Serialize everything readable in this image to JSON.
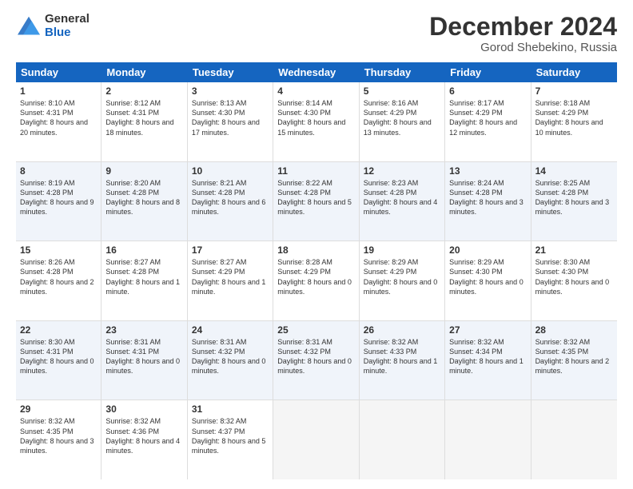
{
  "header": {
    "logo": {
      "general": "General",
      "blue": "Blue"
    },
    "title": "December 2024",
    "subtitle": "Gorod Shebekino, Russia"
  },
  "days_of_week": [
    "Sunday",
    "Monday",
    "Tuesday",
    "Wednesday",
    "Thursday",
    "Friday",
    "Saturday"
  ],
  "weeks": [
    [
      {
        "day": "1",
        "sunrise": "Sunrise: 8:10 AM",
        "sunset": "Sunset: 4:31 PM",
        "daylight": "Daylight: 8 hours and 20 minutes."
      },
      {
        "day": "2",
        "sunrise": "Sunrise: 8:12 AM",
        "sunset": "Sunset: 4:31 PM",
        "daylight": "Daylight: 8 hours and 18 minutes."
      },
      {
        "day": "3",
        "sunrise": "Sunrise: 8:13 AM",
        "sunset": "Sunset: 4:30 PM",
        "daylight": "Daylight: 8 hours and 17 minutes."
      },
      {
        "day": "4",
        "sunrise": "Sunrise: 8:14 AM",
        "sunset": "Sunset: 4:30 PM",
        "daylight": "Daylight: 8 hours and 15 minutes."
      },
      {
        "day": "5",
        "sunrise": "Sunrise: 8:16 AM",
        "sunset": "Sunset: 4:29 PM",
        "daylight": "Daylight: 8 hours and 13 minutes."
      },
      {
        "day": "6",
        "sunrise": "Sunrise: 8:17 AM",
        "sunset": "Sunset: 4:29 PM",
        "daylight": "Daylight: 8 hours and 12 minutes."
      },
      {
        "day": "7",
        "sunrise": "Sunrise: 8:18 AM",
        "sunset": "Sunset: 4:29 PM",
        "daylight": "Daylight: 8 hours and 10 minutes."
      }
    ],
    [
      {
        "day": "8",
        "sunrise": "Sunrise: 8:19 AM",
        "sunset": "Sunset: 4:28 PM",
        "daylight": "Daylight: 8 hours and 9 minutes."
      },
      {
        "day": "9",
        "sunrise": "Sunrise: 8:20 AM",
        "sunset": "Sunset: 4:28 PM",
        "daylight": "Daylight: 8 hours and 8 minutes."
      },
      {
        "day": "10",
        "sunrise": "Sunrise: 8:21 AM",
        "sunset": "Sunset: 4:28 PM",
        "daylight": "Daylight: 8 hours and 6 minutes."
      },
      {
        "day": "11",
        "sunrise": "Sunrise: 8:22 AM",
        "sunset": "Sunset: 4:28 PM",
        "daylight": "Daylight: 8 hours and 5 minutes."
      },
      {
        "day": "12",
        "sunrise": "Sunrise: 8:23 AM",
        "sunset": "Sunset: 4:28 PM",
        "daylight": "Daylight: 8 hours and 4 minutes."
      },
      {
        "day": "13",
        "sunrise": "Sunrise: 8:24 AM",
        "sunset": "Sunset: 4:28 PM",
        "daylight": "Daylight: 8 hours and 3 minutes."
      },
      {
        "day": "14",
        "sunrise": "Sunrise: 8:25 AM",
        "sunset": "Sunset: 4:28 PM",
        "daylight": "Daylight: 8 hours and 3 minutes."
      }
    ],
    [
      {
        "day": "15",
        "sunrise": "Sunrise: 8:26 AM",
        "sunset": "Sunset: 4:28 PM",
        "daylight": "Daylight: 8 hours and 2 minutes."
      },
      {
        "day": "16",
        "sunrise": "Sunrise: 8:27 AM",
        "sunset": "Sunset: 4:28 PM",
        "daylight": "Daylight: 8 hours and 1 minute."
      },
      {
        "day": "17",
        "sunrise": "Sunrise: 8:27 AM",
        "sunset": "Sunset: 4:29 PM",
        "daylight": "Daylight: 8 hours and 1 minute."
      },
      {
        "day": "18",
        "sunrise": "Sunrise: 8:28 AM",
        "sunset": "Sunset: 4:29 PM",
        "daylight": "Daylight: 8 hours and 0 minutes."
      },
      {
        "day": "19",
        "sunrise": "Sunrise: 8:29 AM",
        "sunset": "Sunset: 4:29 PM",
        "daylight": "Daylight: 8 hours and 0 minutes."
      },
      {
        "day": "20",
        "sunrise": "Sunrise: 8:29 AM",
        "sunset": "Sunset: 4:30 PM",
        "daylight": "Daylight: 8 hours and 0 minutes."
      },
      {
        "day": "21",
        "sunrise": "Sunrise: 8:30 AM",
        "sunset": "Sunset: 4:30 PM",
        "daylight": "Daylight: 8 hours and 0 minutes."
      }
    ],
    [
      {
        "day": "22",
        "sunrise": "Sunrise: 8:30 AM",
        "sunset": "Sunset: 4:31 PM",
        "daylight": "Daylight: 8 hours and 0 minutes."
      },
      {
        "day": "23",
        "sunrise": "Sunrise: 8:31 AM",
        "sunset": "Sunset: 4:31 PM",
        "daylight": "Daylight: 8 hours and 0 minutes."
      },
      {
        "day": "24",
        "sunrise": "Sunrise: 8:31 AM",
        "sunset": "Sunset: 4:32 PM",
        "daylight": "Daylight: 8 hours and 0 minutes."
      },
      {
        "day": "25",
        "sunrise": "Sunrise: 8:31 AM",
        "sunset": "Sunset: 4:32 PM",
        "daylight": "Daylight: 8 hours and 0 minutes."
      },
      {
        "day": "26",
        "sunrise": "Sunrise: 8:32 AM",
        "sunset": "Sunset: 4:33 PM",
        "daylight": "Daylight: 8 hours and 1 minute."
      },
      {
        "day": "27",
        "sunrise": "Sunrise: 8:32 AM",
        "sunset": "Sunset: 4:34 PM",
        "daylight": "Daylight: 8 hours and 1 minute."
      },
      {
        "day": "28",
        "sunrise": "Sunrise: 8:32 AM",
        "sunset": "Sunset: 4:35 PM",
        "daylight": "Daylight: 8 hours and 2 minutes."
      }
    ],
    [
      {
        "day": "29",
        "sunrise": "Sunrise: 8:32 AM",
        "sunset": "Sunset: 4:35 PM",
        "daylight": "Daylight: 8 hours and 3 minutes."
      },
      {
        "day": "30",
        "sunrise": "Sunrise: 8:32 AM",
        "sunset": "Sunset: 4:36 PM",
        "daylight": "Daylight: 8 hours and 4 minutes."
      },
      {
        "day": "31",
        "sunrise": "Sunrise: 8:32 AM",
        "sunset": "Sunset: 4:37 PM",
        "daylight": "Daylight: 8 hours and 5 minutes."
      },
      {
        "day": "",
        "sunrise": "",
        "sunset": "",
        "daylight": ""
      },
      {
        "day": "",
        "sunrise": "",
        "sunset": "",
        "daylight": ""
      },
      {
        "day": "",
        "sunrise": "",
        "sunset": "",
        "daylight": ""
      },
      {
        "day": "",
        "sunrise": "",
        "sunset": "",
        "daylight": ""
      }
    ]
  ]
}
